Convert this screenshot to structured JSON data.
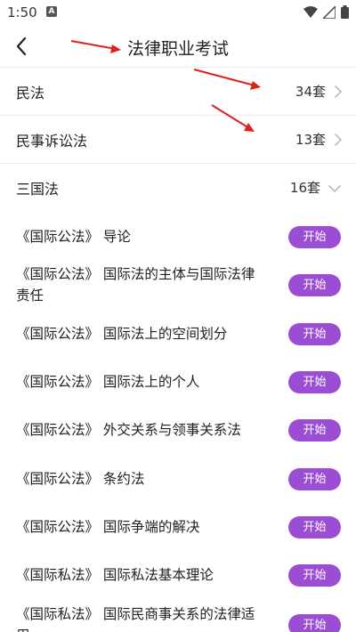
{
  "status_bar": {
    "time": "1:50",
    "notification_icon": "a-square-icon",
    "icons": [
      "wifi-icon",
      "signal-icon",
      "battery-icon"
    ]
  },
  "header": {
    "title": "法律职业考试",
    "back_icon": "chevron-left-icon"
  },
  "categories": [
    {
      "name": "民法",
      "count": "34套",
      "chevron": "chevron-right"
    },
    {
      "name": "民事诉讼法",
      "count": "13套",
      "chevron": "chevron-right"
    },
    {
      "name": "三国法",
      "count": "16套",
      "chevron": "chevron-down"
    }
  ],
  "items": [
    {
      "title": "《国际公法》 导论",
      "button": "开始"
    },
    {
      "title": "《国际公法》 国际法的主体与国际法律责任",
      "button": "开始"
    },
    {
      "title": "《国际公法》 国际法上的空间划分",
      "button": "开始"
    },
    {
      "title": "《国际公法》 国际法上的个人",
      "button": "开始"
    },
    {
      "title": "《国际公法》 外交关系与领事关系法",
      "button": "开始"
    },
    {
      "title": "《国际公法》 条约法",
      "button": "开始"
    },
    {
      "title": "《国际公法》 国际争端的解决",
      "button": "开始"
    },
    {
      "title": "《国际私法》 国际私法基本理论",
      "button": "开始"
    },
    {
      "title": "《国际私法》 国际民商事关系的法律适用",
      "button": "开始"
    }
  ],
  "colors": {
    "accent": "#9b4dd3",
    "annotation": "#e0201b"
  }
}
